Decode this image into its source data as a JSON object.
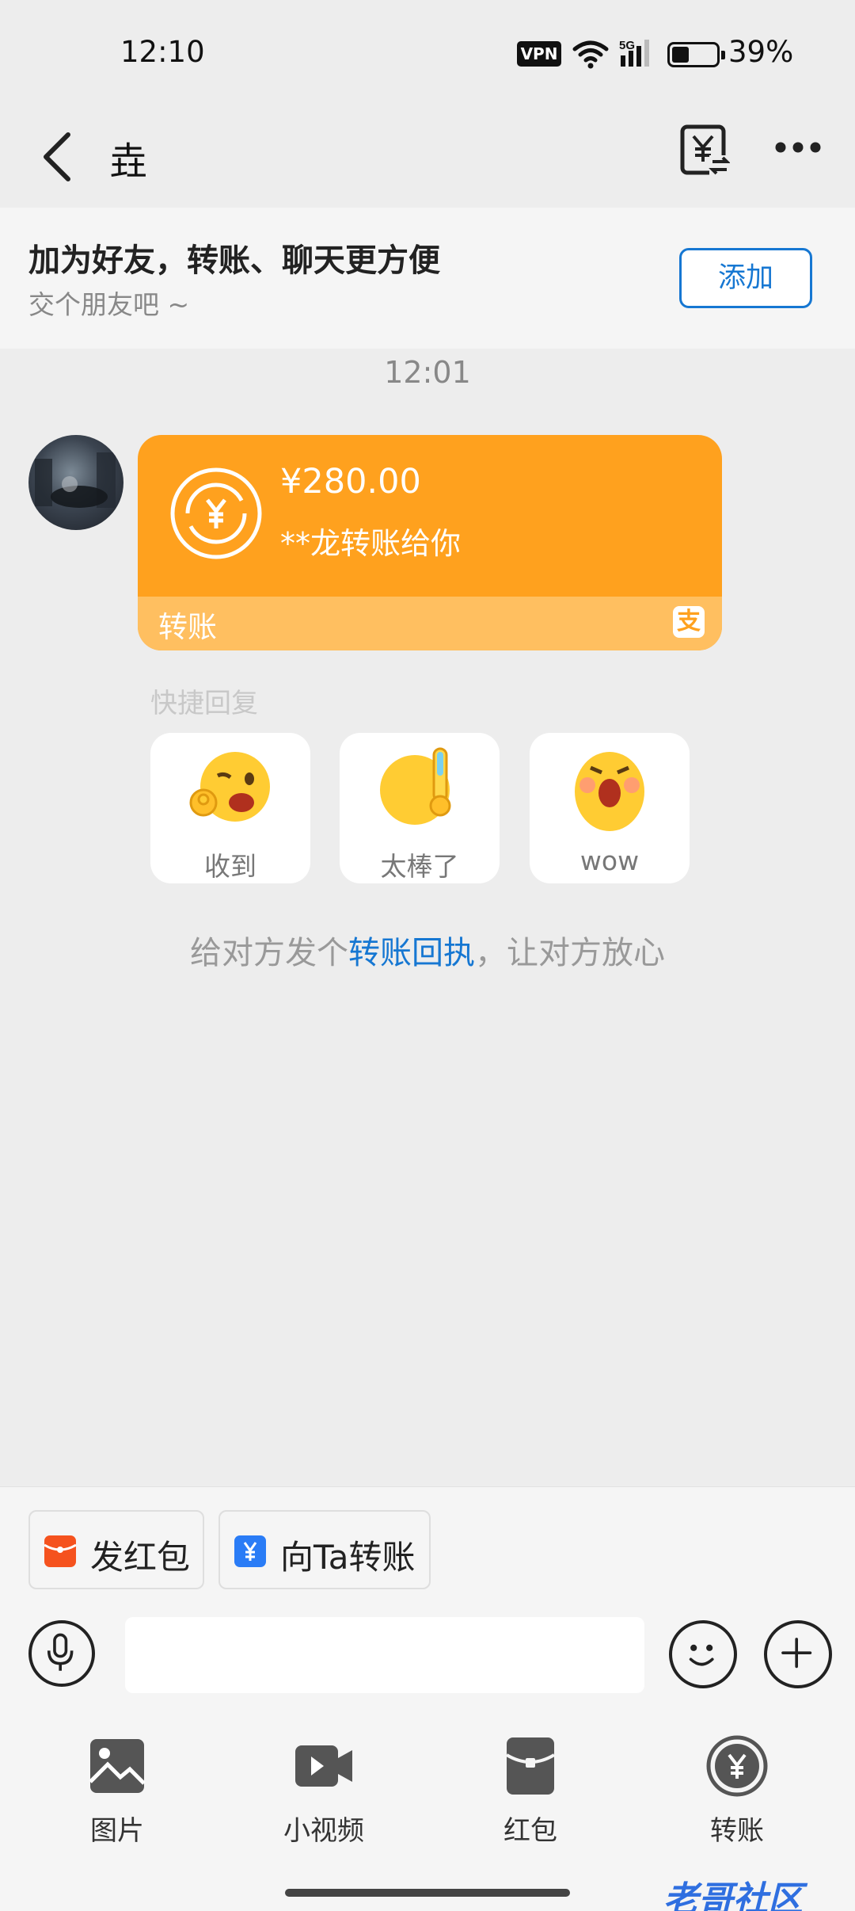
{
  "status_bar": {
    "time": "12:10",
    "vpn": "VPN",
    "network": "5G",
    "battery": "39%"
  },
  "header": {
    "title": "垚",
    "icons": [
      "back-icon",
      "transfer-record-icon",
      "more-icon"
    ]
  },
  "banner": {
    "heading": "加为好友，转账、聊天更方便",
    "sub": "交个朋友吧 ~",
    "add_label": "添加"
  },
  "chat": {
    "timestamp": "12:01",
    "transfer": {
      "amount": "¥280.00",
      "desc": "**龙转账给你",
      "footer": "转账",
      "brand_glyph": "支",
      "color": "#ffa11e"
    },
    "quick_reply_label": "快捷回复",
    "quick_replies": [
      {
        "label": "收到",
        "icon": "ok-wink-emoji"
      },
      {
        "label": "太棒了",
        "icon": "thumbs-up-emoji"
      },
      {
        "label": "wow",
        "icon": "surprised-emoji"
      }
    ],
    "hint": {
      "before": "给对方发个",
      "link": "转账回执",
      "after": "，让对方放心"
    }
  },
  "composer": {
    "chips": [
      {
        "label": "发红包",
        "icon": "red-packet-icon",
        "color": "#f5521e"
      },
      {
        "label": "向Ta转账",
        "icon": "transfer-icon",
        "color": "#2a7cf6"
      }
    ],
    "input_placeholder": ""
  },
  "toolbar": [
    {
      "label": "图片",
      "icon": "image-icon"
    },
    {
      "label": "小视频",
      "icon": "video-icon"
    },
    {
      "label": "红包",
      "icon": "red-packet-icon"
    },
    {
      "label": "转账",
      "icon": "transfer-icon"
    }
  ],
  "watermark": "老哥社区"
}
